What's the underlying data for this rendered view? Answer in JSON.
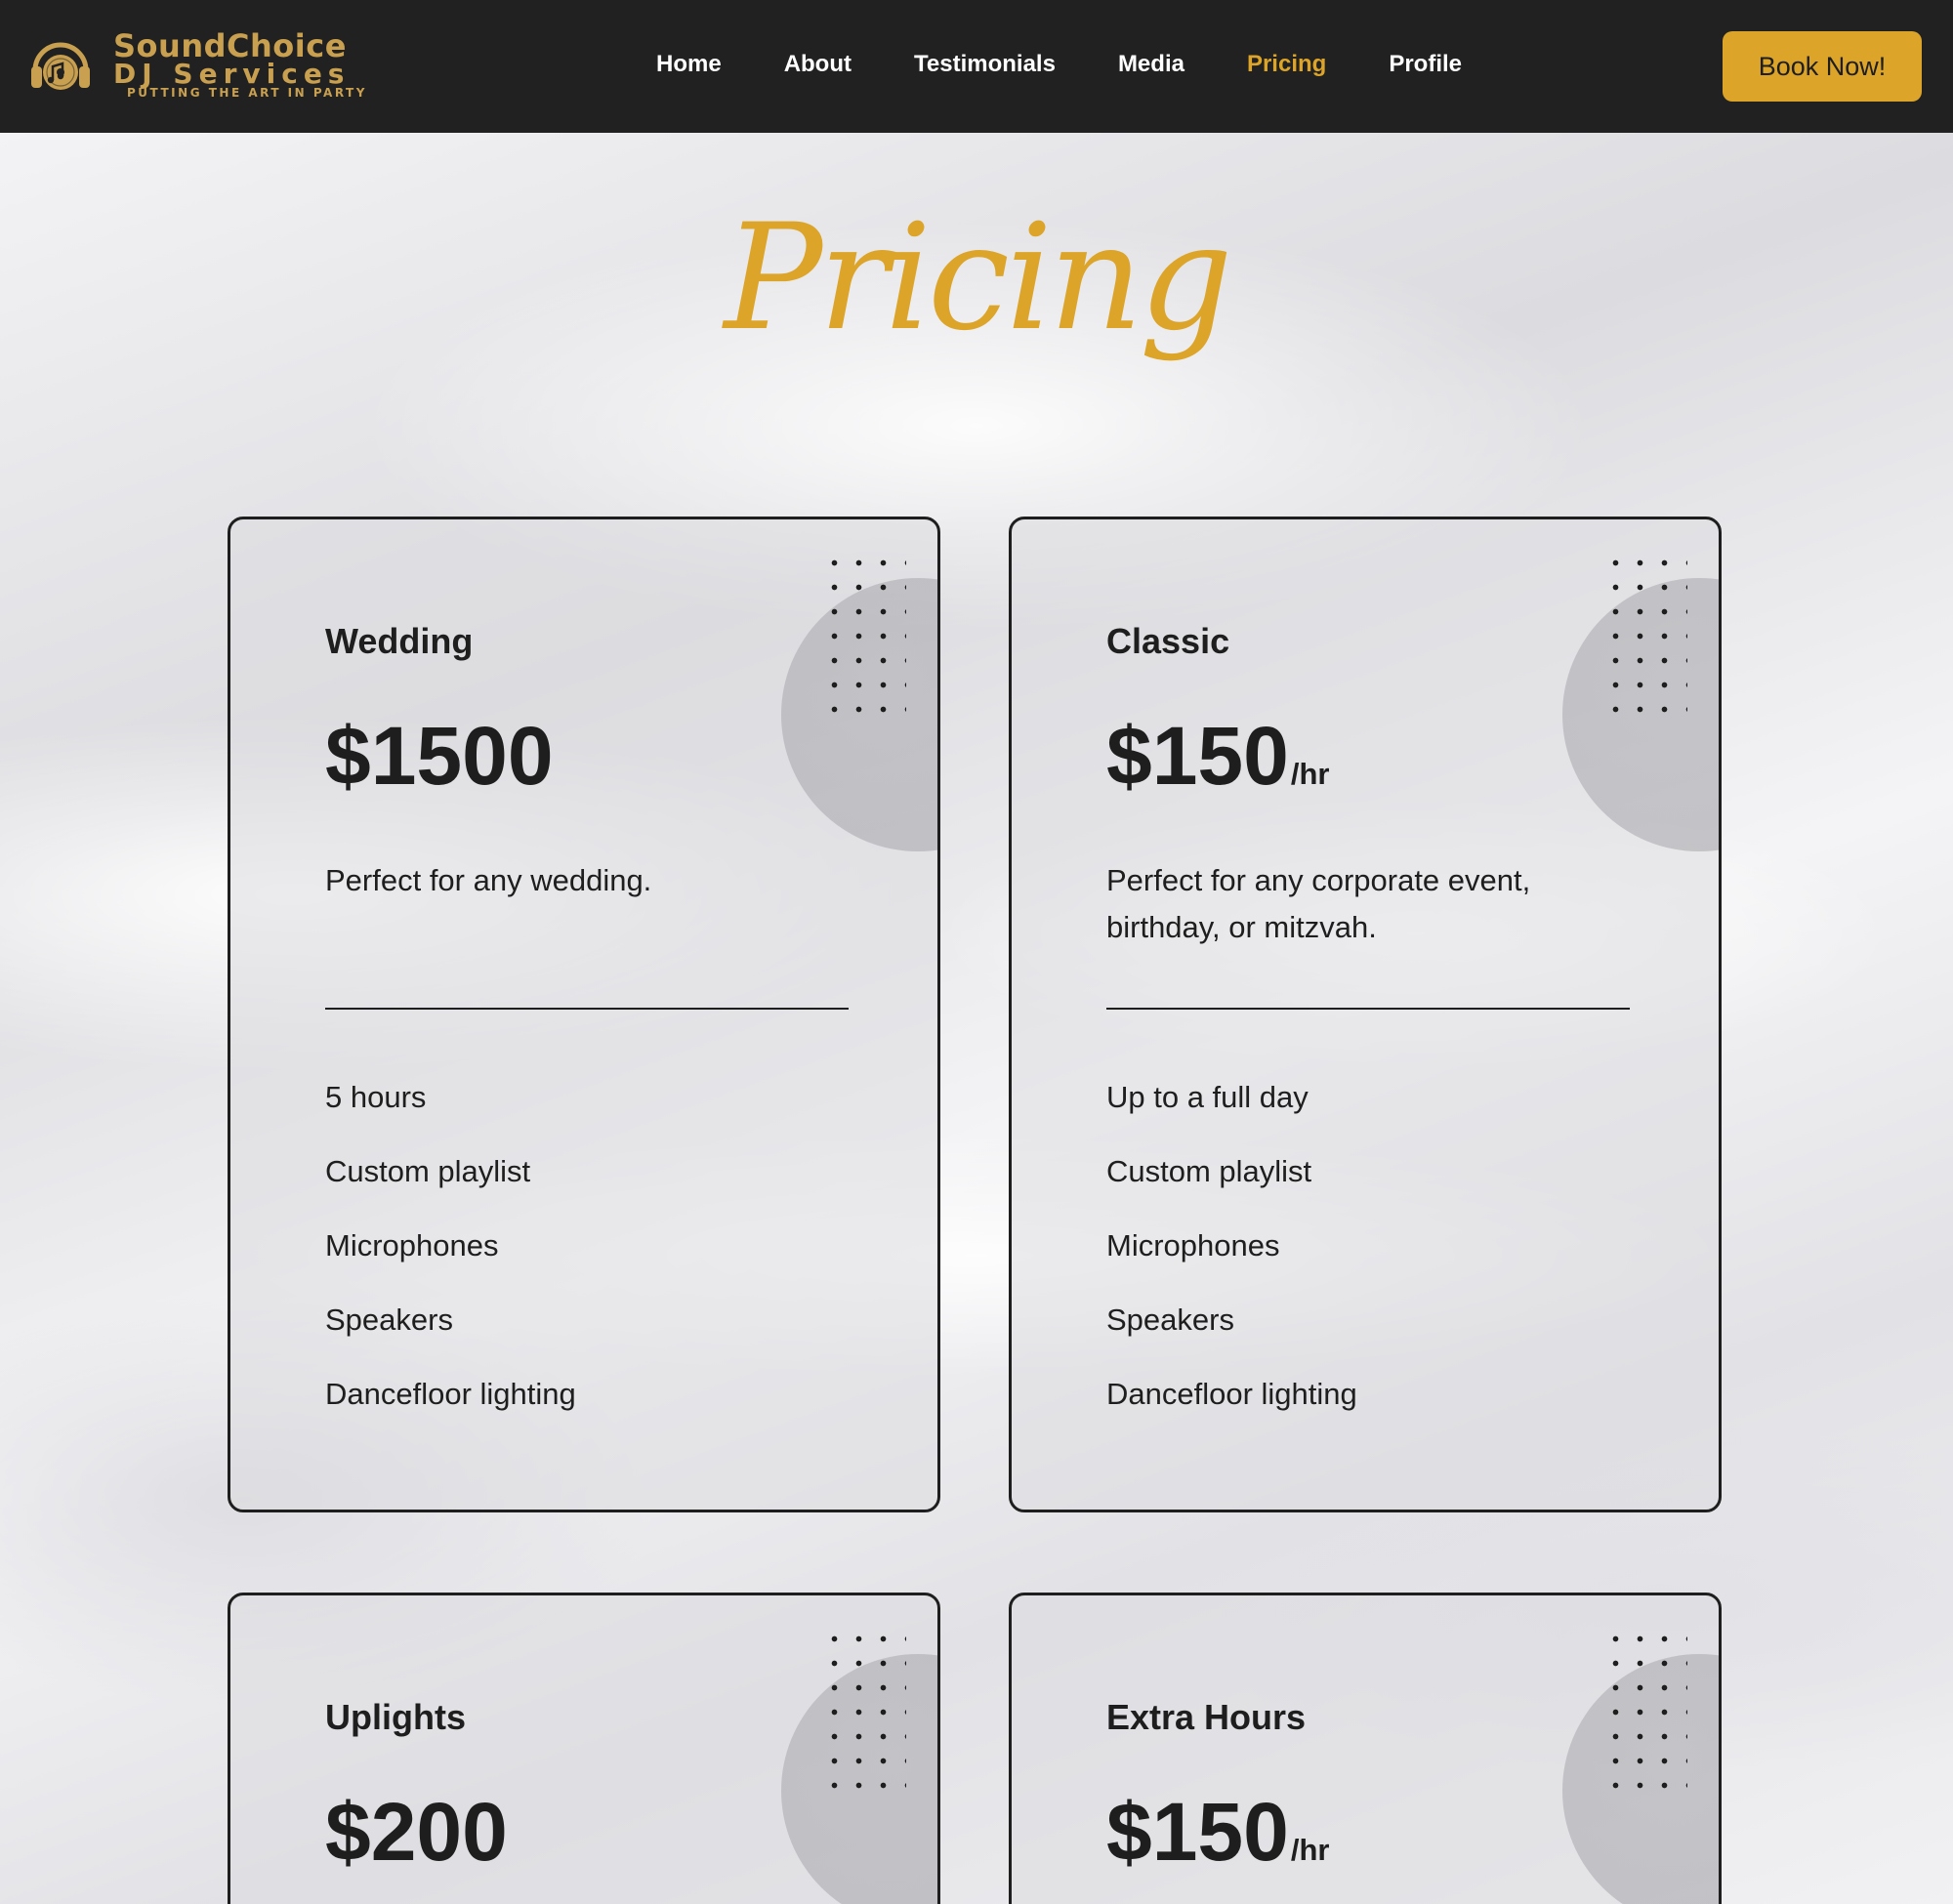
{
  "brand": {
    "name_line1": "SoundChoice",
    "name_line2": "DJ Services",
    "tagline": "Putting the art in party",
    "colors": {
      "gold": "#dca52a",
      "logo_gold": "#c9a050",
      "nav_bg": "#212121"
    },
    "icon": "headphones-record-icon"
  },
  "nav": {
    "items": [
      {
        "label": "Home",
        "active": false
      },
      {
        "label": "About",
        "active": false
      },
      {
        "label": "Testimonials",
        "active": false
      },
      {
        "label": "Media",
        "active": false
      },
      {
        "label": "Pricing",
        "active": true
      },
      {
        "label": "Profile",
        "active": false
      }
    ],
    "cta_label": "Book Now!"
  },
  "page": {
    "title": "Pricing"
  },
  "plans": [
    {
      "name": "Wedding",
      "price": "$1500",
      "unit": "",
      "description": "Perfect for any wedding.",
      "features": [
        "5 hours",
        "Custom playlist",
        "Microphones",
        "Speakers",
        "Dancefloor lighting"
      ]
    },
    {
      "name": "Classic",
      "price": "$150",
      "unit": "/hr",
      "description": "Perfect for any corporate event, birthday, or mitzvah.",
      "features": [
        "Up to a full day",
        "Custom playlist",
        "Microphones",
        "Speakers",
        "Dancefloor lighting"
      ]
    },
    {
      "name": "Uplights",
      "price": "$200",
      "unit": ""
    },
    {
      "name": "Extra Hours",
      "price": "$150",
      "unit": "/hr"
    }
  ]
}
